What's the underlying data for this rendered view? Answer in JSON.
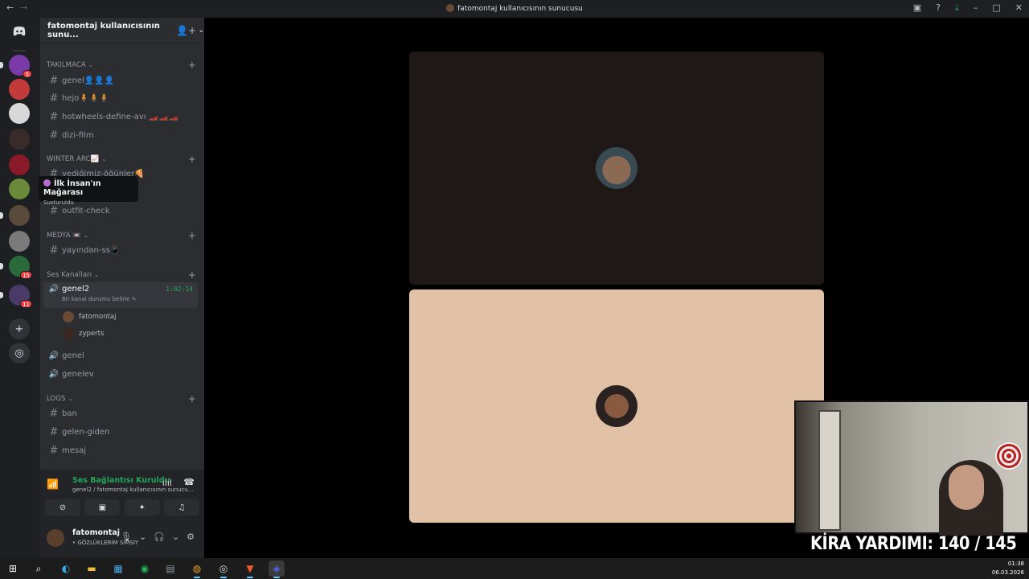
{
  "window": {
    "title": "fatomontaj kullanıcısının sunucusu",
    "nav_back": "←",
    "nav_forward": "→",
    "controls": [
      "▣",
      "?",
      "⤓",
      "–",
      "□",
      "✕"
    ]
  },
  "rail": {
    "home_icon": "discord-icon",
    "servers": [
      {
        "name": "server-1",
        "badge": "5",
        "color": "#7a3aa8"
      },
      {
        "name": "server-2",
        "badge": "",
        "color": "#c23a3a"
      },
      {
        "name": "server-3",
        "badge": "",
        "color": "#d8d8d8"
      },
      {
        "name": "server-4",
        "badge": "",
        "color": "#3a2a2a"
      },
      {
        "name": "server-5",
        "badge": "",
        "color": "#8a1a2a"
      },
      {
        "name": "server-6",
        "badge": "",
        "color": "#6a8a3a"
      },
      {
        "name": "server-7",
        "badge": "",
        "color": "#5a4a3a"
      },
      {
        "name": "server-8",
        "badge": "",
        "color": "#7a7a7a"
      },
      {
        "name": "server-9",
        "badge": "15",
        "color": "#2a6a3a"
      },
      {
        "name": "server-10",
        "badge": "11",
        "color": "#4a3a6a"
      }
    ],
    "add_label": "+",
    "explore_label": "◎"
  },
  "tooltip": {
    "title": "İlk İnsan'ın Mağarası",
    "subtitle": "Susturuldu"
  },
  "sidebar": {
    "server_name": "fatomontaj kullanıcısının sunu...",
    "categories": [
      {
        "name": "TAKILMACA"
      },
      {
        "name": "WINTER ARC📈"
      },
      {
        "name": "MEDYA 📼"
      },
      {
        "name": "Ses Kanalları"
      },
      {
        "name": "LOGS"
      }
    ],
    "text_channels": {
      "genel": "genel👤👤👤",
      "hejo": "hejo🧍🧍🧍",
      "hotwheels": "hotwheels-define-avı 🏎️🏎️🏎️",
      "dizi": "dizi-film",
      "yedik": "yediğimiz-öğünler🍕",
      "outfit": "outfit-check",
      "yayindan": "yayından-ss📱",
      "ban": "ban",
      "gelen": "gelen-giden",
      "mesaj": "mesaj"
    },
    "voice_active": {
      "name": "genel2",
      "timer": "1:02:14",
      "status": "Bir kanal durumu belirle ✎",
      "users": [
        "fatomontaj",
        "zyperts"
      ]
    },
    "voice_channels": [
      "genel",
      "genelev"
    ]
  },
  "voice_panel": {
    "title": "Ses Bağlantısı Kuruldu",
    "subtitle": "genel2 / fatomontaj kullanıcısının sunucu...",
    "buttons": [
      "camera-off-icon",
      "screen-share-icon",
      "activities-icon",
      "soundboard-icon"
    ]
  },
  "user_panel": {
    "username": "fatomontaj",
    "status": "• GÖZLÜKLERİM SİMSİY"
  },
  "overlay": {
    "counter": "KİRA YARDIMI:  140 / 145"
  },
  "taskbar": {
    "time": "01:38",
    "date": "06.03.2026"
  }
}
